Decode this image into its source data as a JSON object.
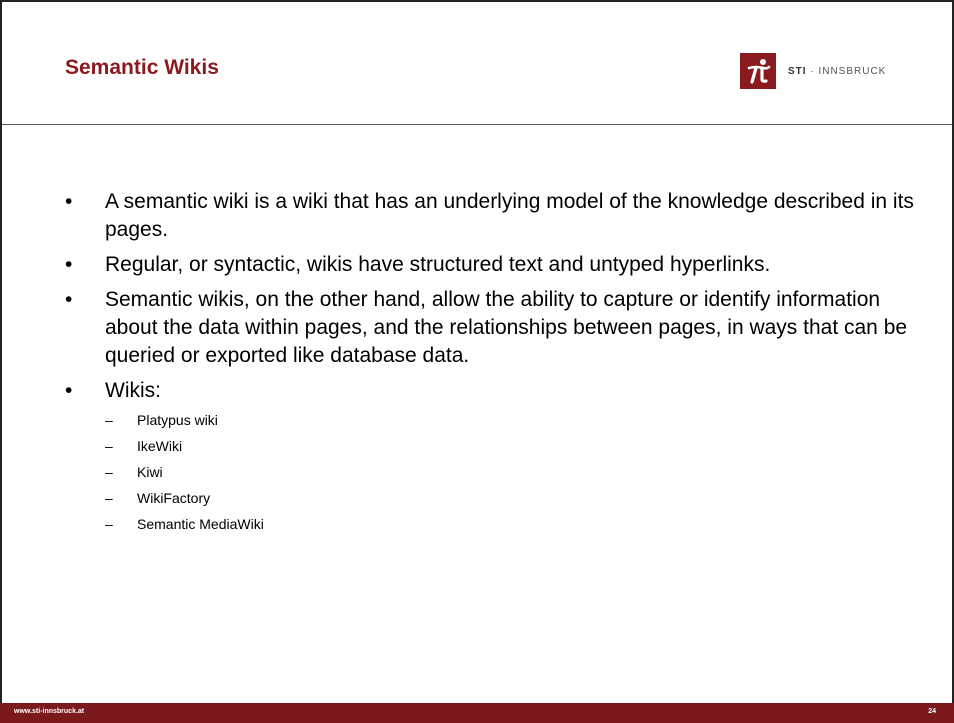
{
  "slide": {
    "title": "Semantic Wikis",
    "logo": {
      "icon": "sti-logo-icon",
      "brand": "STI",
      "separator": " · ",
      "location": "INNSBRUCK"
    },
    "bullets": [
      {
        "text": "A semantic wiki is a wiki that has an underlying model of the knowledge described in its pages."
      },
      {
        "text": "Regular, or syntactic, wikis have structured text and untyped hyperlinks."
      },
      {
        "text": "Semantic wikis, on the other hand, allow the ability to capture or identify information about the data within pages, and the relationships between pages, in ways that can be queried or exported like database data."
      },
      {
        "text": "Wikis:",
        "subitems": [
          "Platypus wiki",
          "IkeWiki",
          "Kiwi",
          "WikiFactory",
          "Semantic MediaWiki"
        ]
      }
    ],
    "bullet_marker": "•",
    "sub_marker": "–",
    "footer": {
      "url": "www.sti-innsbruck.at",
      "page": "24"
    },
    "colors": {
      "accent": "#8b1a1f",
      "footer_bg": "#7a1a1c"
    }
  }
}
